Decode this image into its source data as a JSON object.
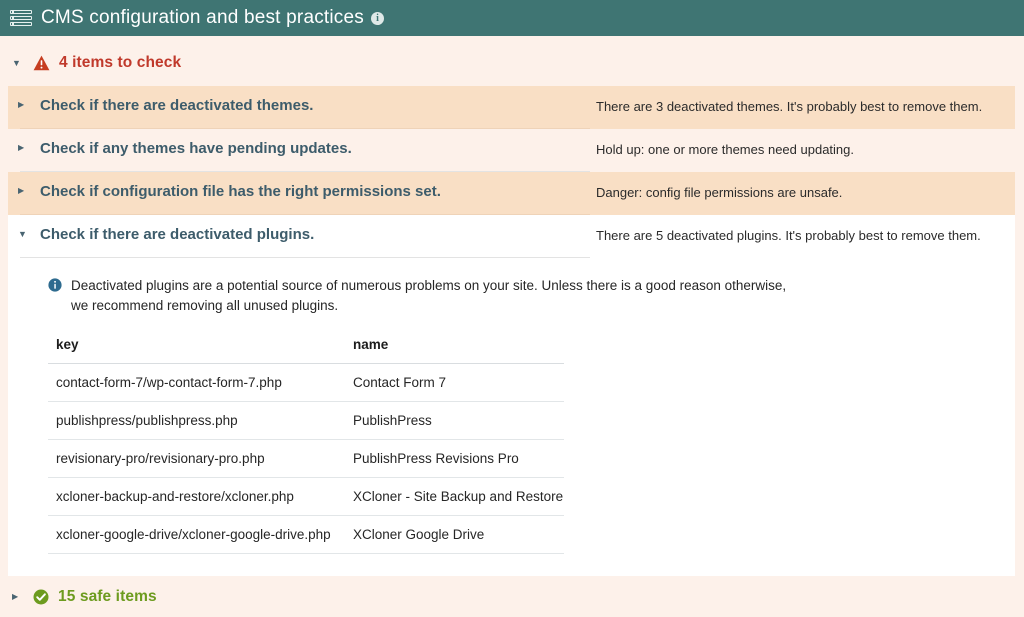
{
  "header": {
    "icon": "server-stack-icon",
    "title": "CMS configuration and best practices",
    "info_icon": "info-icon",
    "bg_color": "#3f7573"
  },
  "groups": {
    "to_check": {
      "label": "4 items to check",
      "icon": "warning-triangle-icon",
      "color": "#c0392b",
      "expanded": true,
      "caret": "▼"
    },
    "safe": {
      "label": "15 safe items",
      "icon": "check-circle-icon",
      "color": "#6d9b1f",
      "expanded": false,
      "caret": "▶"
    }
  },
  "checks": [
    {
      "label": "Check if there are deactivated themes.",
      "message": "There are 3 deactivated themes. It's probably best to remove them.",
      "expanded": false,
      "caret": "▶",
      "highlight": true
    },
    {
      "label": "Check if any themes have pending updates.",
      "message": "Hold up: one or more themes need updating.",
      "expanded": false,
      "caret": "▶",
      "highlight": false
    },
    {
      "label": "Check if configuration file has the right permissions set.",
      "message": "Danger: config file permissions are unsafe.",
      "expanded": false,
      "caret": "▶",
      "highlight": true
    },
    {
      "label": "Check if there are deactivated plugins.",
      "message": "There are 5 deactivated plugins. It's probably best to remove them.",
      "expanded": true,
      "caret": "▼",
      "highlight": false
    }
  ],
  "detail": {
    "note_icon": "info-icon",
    "note": "Deactivated plugins are a potential source of numerous problems on your site. Unless there is a good reason otherwise, we recommend removing all unused plugins.",
    "table": {
      "columns": [
        "key",
        "name"
      ],
      "rows": [
        [
          "contact-form-7/wp-contact-form-7.php",
          "Contact Form 7"
        ],
        [
          "publishpress/publishpress.php",
          "PublishPress"
        ],
        [
          "revisionary-pro/revisionary-pro.php",
          "PublishPress Revisions Pro"
        ],
        [
          "xcloner-backup-and-restore/xcloner.php",
          "XCloner - Site Backup and Restore"
        ],
        [
          "xcloner-google-drive/xcloner-google-drive.php",
          "XCloner Google Drive"
        ]
      ]
    }
  },
  "colors": {
    "page_bg": "#fdf1ea",
    "row_highlight": "#f9dfc5",
    "header_teal": "#3f7573",
    "check_title": "#3d5c6b",
    "warning_red": "#c0392b",
    "safe_green": "#6d9b1f"
  }
}
